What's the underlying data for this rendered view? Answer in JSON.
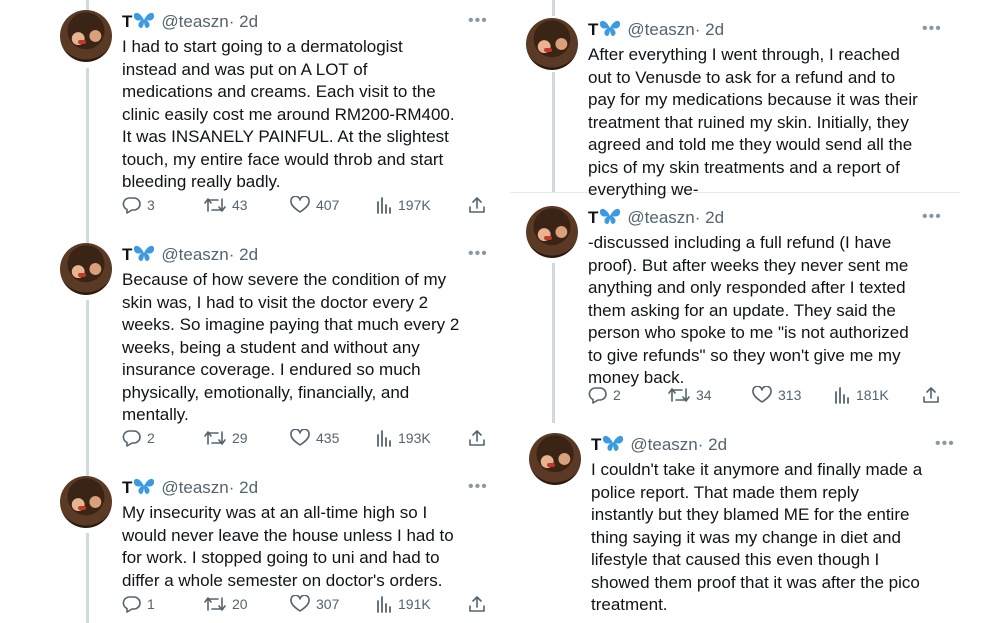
{
  "left_column": [
    {
      "name": "T",
      "handle": "@teaszn",
      "time": "· 2d",
      "more": "•••",
      "lines": [
        "I had to start going to a dermatologist",
        "instead and was put on A LOT of",
        "medications and creams. Each visit to the",
        "clinic easily cost me around RM200-RM400.",
        "It was INSANELY PAINFUL. At the slightest",
        "touch, my entire face would throb and start",
        "bleeding really badly."
      ],
      "stats": {
        "replies": "3",
        "retweets": "43",
        "likes": "407",
        "views": "197K"
      }
    },
    {
      "name": "T",
      "handle": "@teaszn",
      "time": "· 2d",
      "more": "•••",
      "lines": [
        "Because of how severe the condition of my",
        "skin was, I had to visit the doctor every 2",
        "weeks. So imagine paying that much every 2",
        "weeks, being a student and without any",
        "insurance coverage. I endured so much",
        "physically, emotionally, financially, and",
        "mentally."
      ],
      "stats": {
        "replies": "2",
        "retweets": "29",
        "likes": "435",
        "views": "193K"
      }
    },
    {
      "name": "T",
      "handle": "@teaszn",
      "time": "· 2d",
      "more": "•••",
      "lines": [
        "My insecurity was at an all-time high so I",
        "would never leave the house unless I had to",
        "for work. I stopped going to uni and had to",
        "differ a whole semester on doctor's orders."
      ],
      "stats": {
        "replies": "1",
        "retweets": "20",
        "likes": "307",
        "views": "191K"
      }
    }
  ],
  "right_column": [
    {
      "name": "T",
      "handle": "@teaszn",
      "time": "· 2d",
      "more": "•••",
      "lines": [
        "After everything  I went through, I reached",
        "out to Venusde to ask for a refund and to",
        "pay for my medications because it was their",
        "treatment that ruined my skin. Initially, they",
        "agreed and told me they would send all the",
        "pics of my skin treatments and a report of",
        "everything we-"
      ]
    },
    {
      "name": "T",
      "handle": "@teaszn",
      "time": "· 2d",
      "more": "•••",
      "lines": [
        "-discussed including a full refund (I have",
        "proof). But after weeks they never sent me",
        "anything and only responded after I texted",
        "them asking for an update. They said the",
        "person who spoke to me \"is not authorized",
        "to give refunds\" so they won't give me my",
        "money back."
      ],
      "stats": {
        "replies": "2",
        "retweets": "34",
        "likes": "313",
        "views": "181K"
      }
    },
    {
      "name": "T",
      "handle": "@teaszn",
      "time": "· 2d",
      "more": "•••",
      "lines": [
        "I couldn't take it anymore and finally made a",
        "police report. That made them reply",
        "instantly but they blamed ME for the entire",
        "thing saying it was my change in diet and",
        "lifestyle that caused this even though I",
        "showed them proof that it was after the pico",
        "treatment."
      ]
    }
  ],
  "icons": {
    "butterfly_color": "#3b9ae1",
    "reply": "reply-icon",
    "retweet": "retweet-icon",
    "like": "like-icon",
    "views": "views-icon",
    "share": "share-icon"
  }
}
